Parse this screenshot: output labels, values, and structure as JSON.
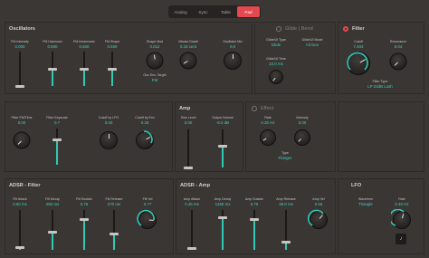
{
  "tabs": [
    {
      "label": "Analog"
    },
    {
      "label": "Sync"
    },
    {
      "label": "Table"
    },
    {
      "label": "Pad"
    }
  ],
  "active_tab": "Pad",
  "oscillators": {
    "title": "Oscillators",
    "sliders": [
      {
        "label": "FM Intensity",
        "value": "0.000"
      },
      {
        "label": "FM Harmonic",
        "value": "0.500"
      },
      {
        "label": "FM Inharmonic",
        "value": "0.500"
      },
      {
        "label": "FM Shape",
        "value": "0.500"
      }
    ],
    "knobs": [
      {
        "label": "Shape Mod",
        "value": "0.012"
      },
      {
        "label": "Vibrato Depth",
        "value": "0.43 cent"
      },
      {
        "label": "Oscillator Mix",
        "value": "0.0"
      }
    ],
    "osc_env_target": {
      "label": "Osc Env. Target",
      "value": "FM"
    }
  },
  "glide": {
    "title": "Glide | Bend",
    "glide_type": {
      "label": "Glide/UI Type",
      "value": "Glide"
    },
    "glide_mode": {
      "label": "Glide/UI Mode",
      "value": "All Gen"
    },
    "glide_time": {
      "label": "Glide/UI Time",
      "value": "10.0 ms"
    }
  },
  "filter": {
    "title": "Filter",
    "cutoff": {
      "label": "Cutoff",
      "value": "7.404"
    },
    "resonance": {
      "label": "Resonance",
      "value": "0.04"
    },
    "filter_type": {
      "label": "Filter Type",
      "value": "LP 24dB Lush"
    }
  },
  "fm_row": {
    "items": [
      {
        "label": "Filter FM/Time",
        "value": "0.00"
      },
      {
        "label": "Filter Keyscale",
        "value": "0.7"
      },
      {
        "label": "Cutoff by LFO",
        "value": "0.00"
      },
      {
        "label": "Cutoff by Env",
        "value": "0.25"
      }
    ]
  },
  "amp": {
    "title": "Amp",
    "sine_level": {
      "label": "Sine Level",
      "value": "0.00"
    },
    "output_volume": {
      "label": "Output Volume",
      "value": "-6.0 dB"
    }
  },
  "effect": {
    "title": "Effect",
    "rate": {
      "label": "Rate",
      "value": "0.20 Hz"
    },
    "intensity": {
      "label": "Intensity",
      "value": "0.00"
    },
    "type": {
      "label": "Type",
      "value": "Flanger"
    }
  },
  "adsr_filter": {
    "title": "ADSR - Filter",
    "items": [
      {
        "label": "Filt Attack",
        "value": "0.60 ms"
      },
      {
        "label": "Filt Decay",
        "value": "250 ms"
      },
      {
        "label": "Filt Sustain",
        "value": "0.76"
      },
      {
        "label": "Filt Release",
        "value": "270 ms"
      },
      {
        "label": "Filt Vel",
        "value": "0.77"
      }
    ]
  },
  "adsr_amp": {
    "title": "ADSR - Amp",
    "items": [
      {
        "label": "Amp Attack",
        "value": "0.45 ms"
      },
      {
        "label": "Amp Decay",
        "value": "1360 ms"
      },
      {
        "label": "Amp Sustain",
        "value": "0.76"
      },
      {
        "label": "Amp Release",
        "value": "38.0 ms"
      },
      {
        "label": "Amp Vel",
        "value": "0.65"
      }
    ]
  },
  "lfo": {
    "title": "LFO",
    "waveform": {
      "label": "Waveform",
      "value": "Triangle"
    },
    "rate": {
      "label": "Rate",
      "value": "0.40 Hz"
    },
    "note_symbol": "♪"
  },
  "levels": {
    "osc_sliders": [
      0.0,
      0.5,
      0.5,
      0.5
    ],
    "filter_keyscale": 0.7,
    "sine_level": 0.0,
    "output_volume": 0.55,
    "adsr_filter": [
      0.05,
      0.45,
      0.76,
      0.4
    ],
    "adsr_amp": [
      0.04,
      0.8,
      0.76,
      0.2
    ]
  },
  "colors": {
    "accent": "#2fc9b6",
    "active_tab": "#e5484e",
    "power_on": "#e5484e"
  }
}
